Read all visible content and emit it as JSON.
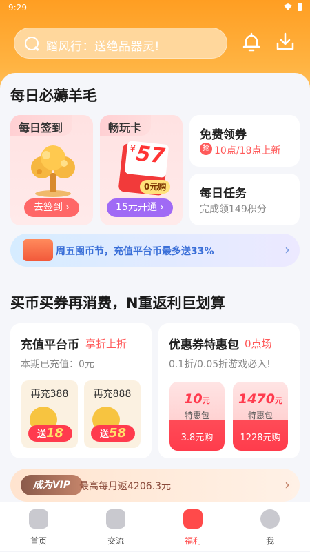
{
  "status": {
    "time": "9:29"
  },
  "search": {
    "text": "踏风行：送绝品器灵!"
  },
  "section1": {
    "title": "每日必薅羊毛",
    "checkin": {
      "title": "每日签到",
      "button": "去签到"
    },
    "playcard": {
      "title": "畅玩卡",
      "price": "57",
      "free": "0元购",
      "button": "15元开通"
    },
    "coupon": {
      "title": "免费领券",
      "badge": "抢",
      "subtitle": "10点/18点上新"
    },
    "task": {
      "title": "每日任务",
      "subtitle": "完成领149积分"
    },
    "banner": {
      "text": "周五囤币节，充值平台币最多送33%"
    }
  },
  "section2": {
    "title": "买币买券再消费，N重返利巨划算",
    "recharge": {
      "title": "充值平台币",
      "tag": "享折上折",
      "subtitle": "本期已充值：0元",
      "items": [
        {
          "label": "再充388",
          "bonus_prefix": "送",
          "bonus": "18"
        },
        {
          "label": "再充888",
          "bonus_prefix": "送",
          "bonus": "58"
        }
      ]
    },
    "pack": {
      "title": "优惠券特惠包",
      "tag": "0点场",
      "subtitle": "0.1折/0.05折游戏必入!",
      "items": [
        {
          "amount": "10",
          "unit": "元",
          "name": "特惠包",
          "price": "3.8元购"
        },
        {
          "amount": "1470",
          "unit": "元",
          "name": "特惠包",
          "price": "1228元购"
        }
      ]
    },
    "vip": {
      "badge": "成为VIP",
      "text": "最高每月返4206.3元"
    }
  },
  "nav": [
    {
      "label": "首页"
    },
    {
      "label": "交流"
    },
    {
      "label": "福利"
    },
    {
      "label": "我"
    }
  ],
  "colors": {
    "accent": "#ff9e22",
    "nav_active": "#ff4a4a",
    "button_red": "#ff6767",
    "button_purple": "#a06af5"
  }
}
